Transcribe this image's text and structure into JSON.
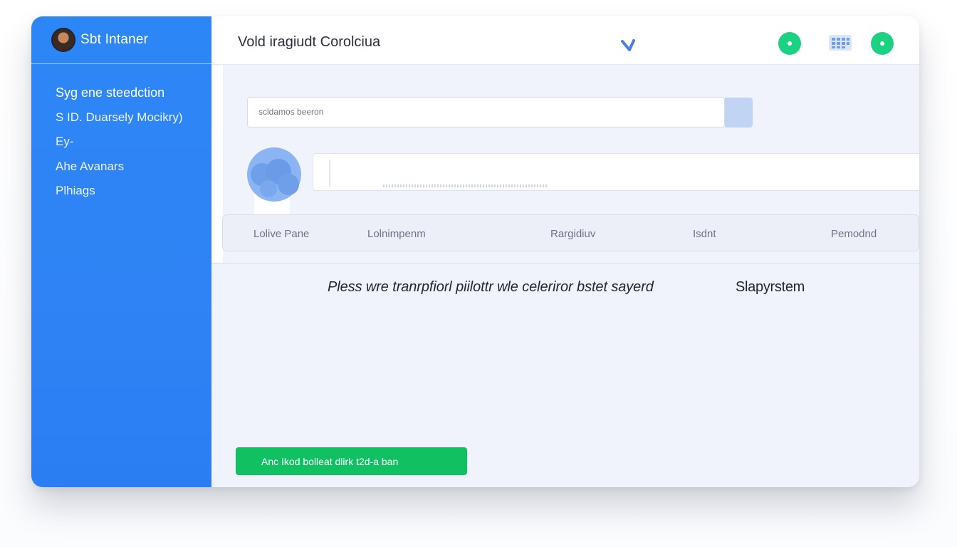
{
  "app": {
    "brand_name": "Sbt Intaner",
    "window_title": "Vold iragiudt Corolciua"
  },
  "sidebar": {
    "items": [
      {
        "label": "Syg ene steedction"
      },
      {
        "label": "S ID. Duarsely Mocikry)"
      },
      {
        "label": "Ey-"
      },
      {
        "label": "Ahe Avanars"
      },
      {
        "label": "Plhiags"
      }
    ]
  },
  "search": {
    "value": "",
    "placeholder": "scldamos beeron"
  },
  "table": {
    "columns": [
      "Lolive Pane",
      "Lolnimpenm",
      "Rargidiuv",
      "Isdnt",
      "Pemodnd"
    ]
  },
  "content": {
    "message": "Pless wre tranrpfiorl piilottr wle celeriror bstet sayerd",
    "message_secondary": "Slapyrstem"
  },
  "actions": {
    "primary_label": "Anc Ikod bolleat dlirk t2d-a ban"
  },
  "colors": {
    "sidebar": "#2D86F6",
    "accent_green": "#1BD182",
    "button_green": "#11C161",
    "background": "#F0F3FB"
  },
  "icons": {
    "top_chevron": "chevron-down-icon",
    "status_left": "status-dot-icon",
    "grid": "grid-icon",
    "status_right": "status-dot-icon",
    "cloud": "cloud-icon"
  }
}
